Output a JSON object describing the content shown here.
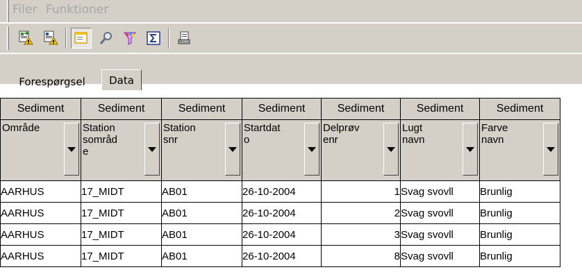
{
  "menu": {
    "items": [
      "Filer",
      "Funktioner"
    ]
  },
  "toolbar": {
    "buttons": [
      {
        "name": "import-icon",
        "pressed": false
      },
      {
        "name": "export-icon",
        "pressed": false
      },
      {
        "name": "window-view-icon",
        "pressed": true
      },
      {
        "name": "search-icon",
        "pressed": false
      },
      {
        "name": "filter-funnel-icon",
        "pressed": false
      },
      {
        "name": "sigma-sum-icon",
        "pressed": false
      },
      {
        "name": "print-icon",
        "pressed": false
      }
    ]
  },
  "tabs": [
    {
      "label": "Forespørgsel",
      "active": false
    },
    {
      "label": "Data",
      "active": true
    }
  ],
  "grid": {
    "group_headers": [
      "Sediment",
      "Sediment",
      "Sediment",
      "Sediment",
      "Sediment",
      "Sediment",
      "Sediment"
    ],
    "columns": [
      {
        "label": "Område"
      },
      {
        "label": "Station\nsområd\ne"
      },
      {
        "label": "Station\nsnr"
      },
      {
        "label": "Startdat\no"
      },
      {
        "label": "Delprøv\nenr"
      },
      {
        "label": "Lugt\nnavn"
      },
      {
        "label": "Farve\nnavn"
      }
    ],
    "rows": [
      [
        "AARHUS",
        "17_MIDT",
        "AB01",
        "26-10-2004",
        "1",
        "Svag svovll",
        "Brunlig"
      ],
      [
        "AARHUS",
        "17_MIDT",
        "AB01",
        "26-10-2004",
        "2",
        "Svag svovll",
        "Brunlig"
      ],
      [
        "AARHUS",
        "17_MIDT",
        "AB01",
        "26-10-2004",
        "3",
        "Svag svovll",
        "Brunlig"
      ],
      [
        "AARHUS",
        "17_MIDT",
        "AB01",
        "26-10-2004",
        "8",
        "Svag svovll",
        "Brunlig"
      ]
    ]
  }
}
